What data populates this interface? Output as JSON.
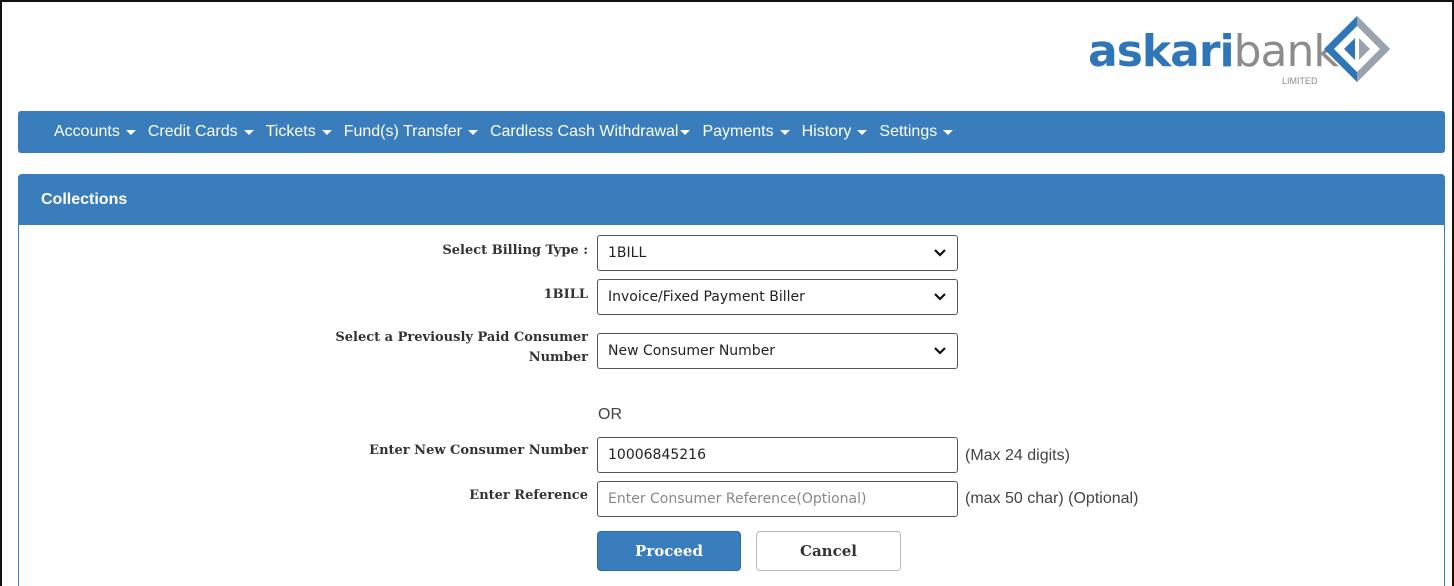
{
  "brand": {
    "name_part1": "askari",
    "name_part2": "bank",
    "suffix": "LIMITED",
    "colors": {
      "blue": "#2f76b9",
      "grey": "#8c8c8c"
    }
  },
  "nav": {
    "items": [
      {
        "label": "Accounts"
      },
      {
        "label": "Credit Cards"
      },
      {
        "label": "Tickets"
      },
      {
        "label": "Fund(s) Transfer"
      },
      {
        "label": "Cardless Cash Withdrawal"
      },
      {
        "label": "Payments"
      },
      {
        "label": "History"
      },
      {
        "label": "Settings"
      }
    ],
    "color": "#3a7dbd"
  },
  "panel": {
    "title": "Collections"
  },
  "form": {
    "billing_type": {
      "label": "Select Billing Type :",
      "value": "1BILL"
    },
    "biller": {
      "label": "1BILL",
      "value": "Invoice/Fixed Payment Biller"
    },
    "prev_consumer": {
      "label_line1": "Select a Previously Paid Consumer",
      "label_line2": "Number",
      "value": "New Consumer Number"
    },
    "or_text": "OR",
    "new_consumer": {
      "label": "Enter New Consumer Number",
      "value": "10006845216",
      "hint": "(Max 24 digits)"
    },
    "reference": {
      "label": "Enter Reference",
      "placeholder": "Enter Consumer Reference(Optional)",
      "hint": "(max 50 char) (Optional)"
    },
    "proceed_label": "Proceed",
    "cancel_label": "Cancel"
  }
}
